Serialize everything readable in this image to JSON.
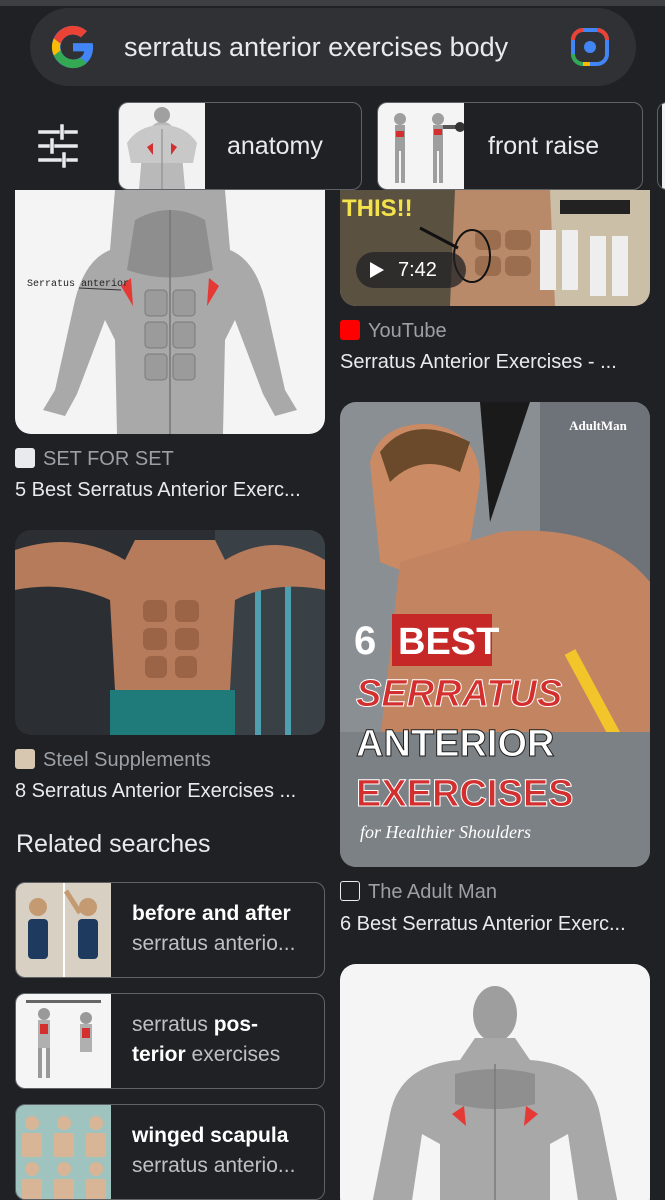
{
  "search": {
    "query": "serratus anterior exercises body"
  },
  "chips": [
    {
      "label": "anatomy"
    },
    {
      "label": "front raise"
    }
  ],
  "left_results": [
    {
      "source": "SET FOR SET",
      "title": "5 Best Serratus Anterior Exerc...",
      "image_label": "Serratus anterior"
    },
    {
      "source": "Steel Supplements",
      "title": "8 Serratus Anterior Exercises ..."
    }
  ],
  "right_results": [
    {
      "source": "YouTube",
      "title": "Serratus Anterior Exercises - ...",
      "duration": "7:42",
      "image_label": "THIS!!"
    },
    {
      "source": "The Adult Man",
      "title": "6 Best Serratus Anterior Exerc...",
      "image_text": {
        "brand": "AdultMan",
        "num": "6",
        "best": "BEST",
        "l1": "SERRATUS",
        "l2": "ANTERIOR",
        "l3": "EXERCISES",
        "sub": "for Healthier Shoulders"
      }
    },
    {
      "source": "",
      "title": ""
    }
  ],
  "related": {
    "heading": "Related searches",
    "items": [
      {
        "line1_bold": "before and after",
        "line1_rest": "",
        "line2_bold": "",
        "line2_rest": "serratus anterio..."
      },
      {
        "line1_bold": "pos-",
        "line1_pre": "serratus ",
        "line2_bold": "terior",
        "line2_rest": " exercises"
      },
      {
        "line1_bold": "winged scapula",
        "line1_rest": "",
        "line2_bold": "",
        "line2_rest": "serratus anterio..."
      }
    ]
  },
  "icons": {
    "logo": "google-g-logo",
    "lens": "google-lens-icon",
    "filter": "tune-filter-icon",
    "youtube": "youtube-icon"
  },
  "colors": {
    "background": "#202124",
    "text": "#e8eaed",
    "muted": "#9aa0a6",
    "accent_red": "#d32f2f"
  }
}
